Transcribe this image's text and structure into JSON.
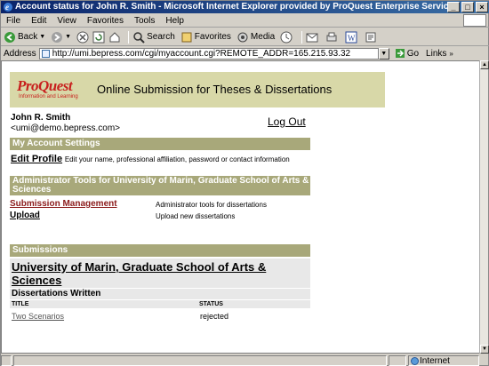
{
  "window": {
    "title": "Account status for John R. Smith - Microsoft Internet Explorer provided by ProQuest Enterprise Services"
  },
  "menu": [
    "File",
    "Edit",
    "View",
    "Favorites",
    "Tools",
    "Help"
  ],
  "toolbar": {
    "back": "Back",
    "search": "Search",
    "favorites": "Favorites",
    "media": "Media"
  },
  "address": {
    "label": "Address",
    "url": "http://umi.bepress.com/cgi/myaccount.cgi?REMOTE_ADDR=165.215.93.32",
    "go": "Go",
    "links": "Links"
  },
  "status": {
    "zone": "Internet"
  },
  "page": {
    "logo_main": "ProQuest",
    "logo_sub": "Information and Learning",
    "banner_title": "Online Submission for Theses & Dissertations",
    "user_name": "John R. Smith",
    "user_email": "<umi@demo.bepress.com>",
    "logout": "Log Out",
    "account_settings_header": "My Account Settings",
    "edit_profile": "Edit Profile",
    "edit_profile_desc": "Edit your name, professional affiliation, password or contact information",
    "admin_header": "Administrator Tools for University of Marin, Graduate School of Arts & Sciences",
    "submission_mgmt": "Submission Management",
    "submission_mgmt_desc": "Administrator tools for dissertations",
    "upload": "Upload",
    "upload_desc": "Upload new dissertations",
    "submissions_header": "Submissions",
    "institution": "University of Marin, Graduate School of Arts & Sciences",
    "dissertations_written": "Dissertations Written",
    "col_title": "TITLE",
    "col_status": "STATUS",
    "rows": [
      {
        "title": "Two Scenarios",
        "status": "rejected"
      }
    ]
  },
  "colors": {
    "section_header": "#a8a87a",
    "banner": "#d8d8a8",
    "logo_red": "#c8201e",
    "link_maroon": "#8b1a1a"
  }
}
